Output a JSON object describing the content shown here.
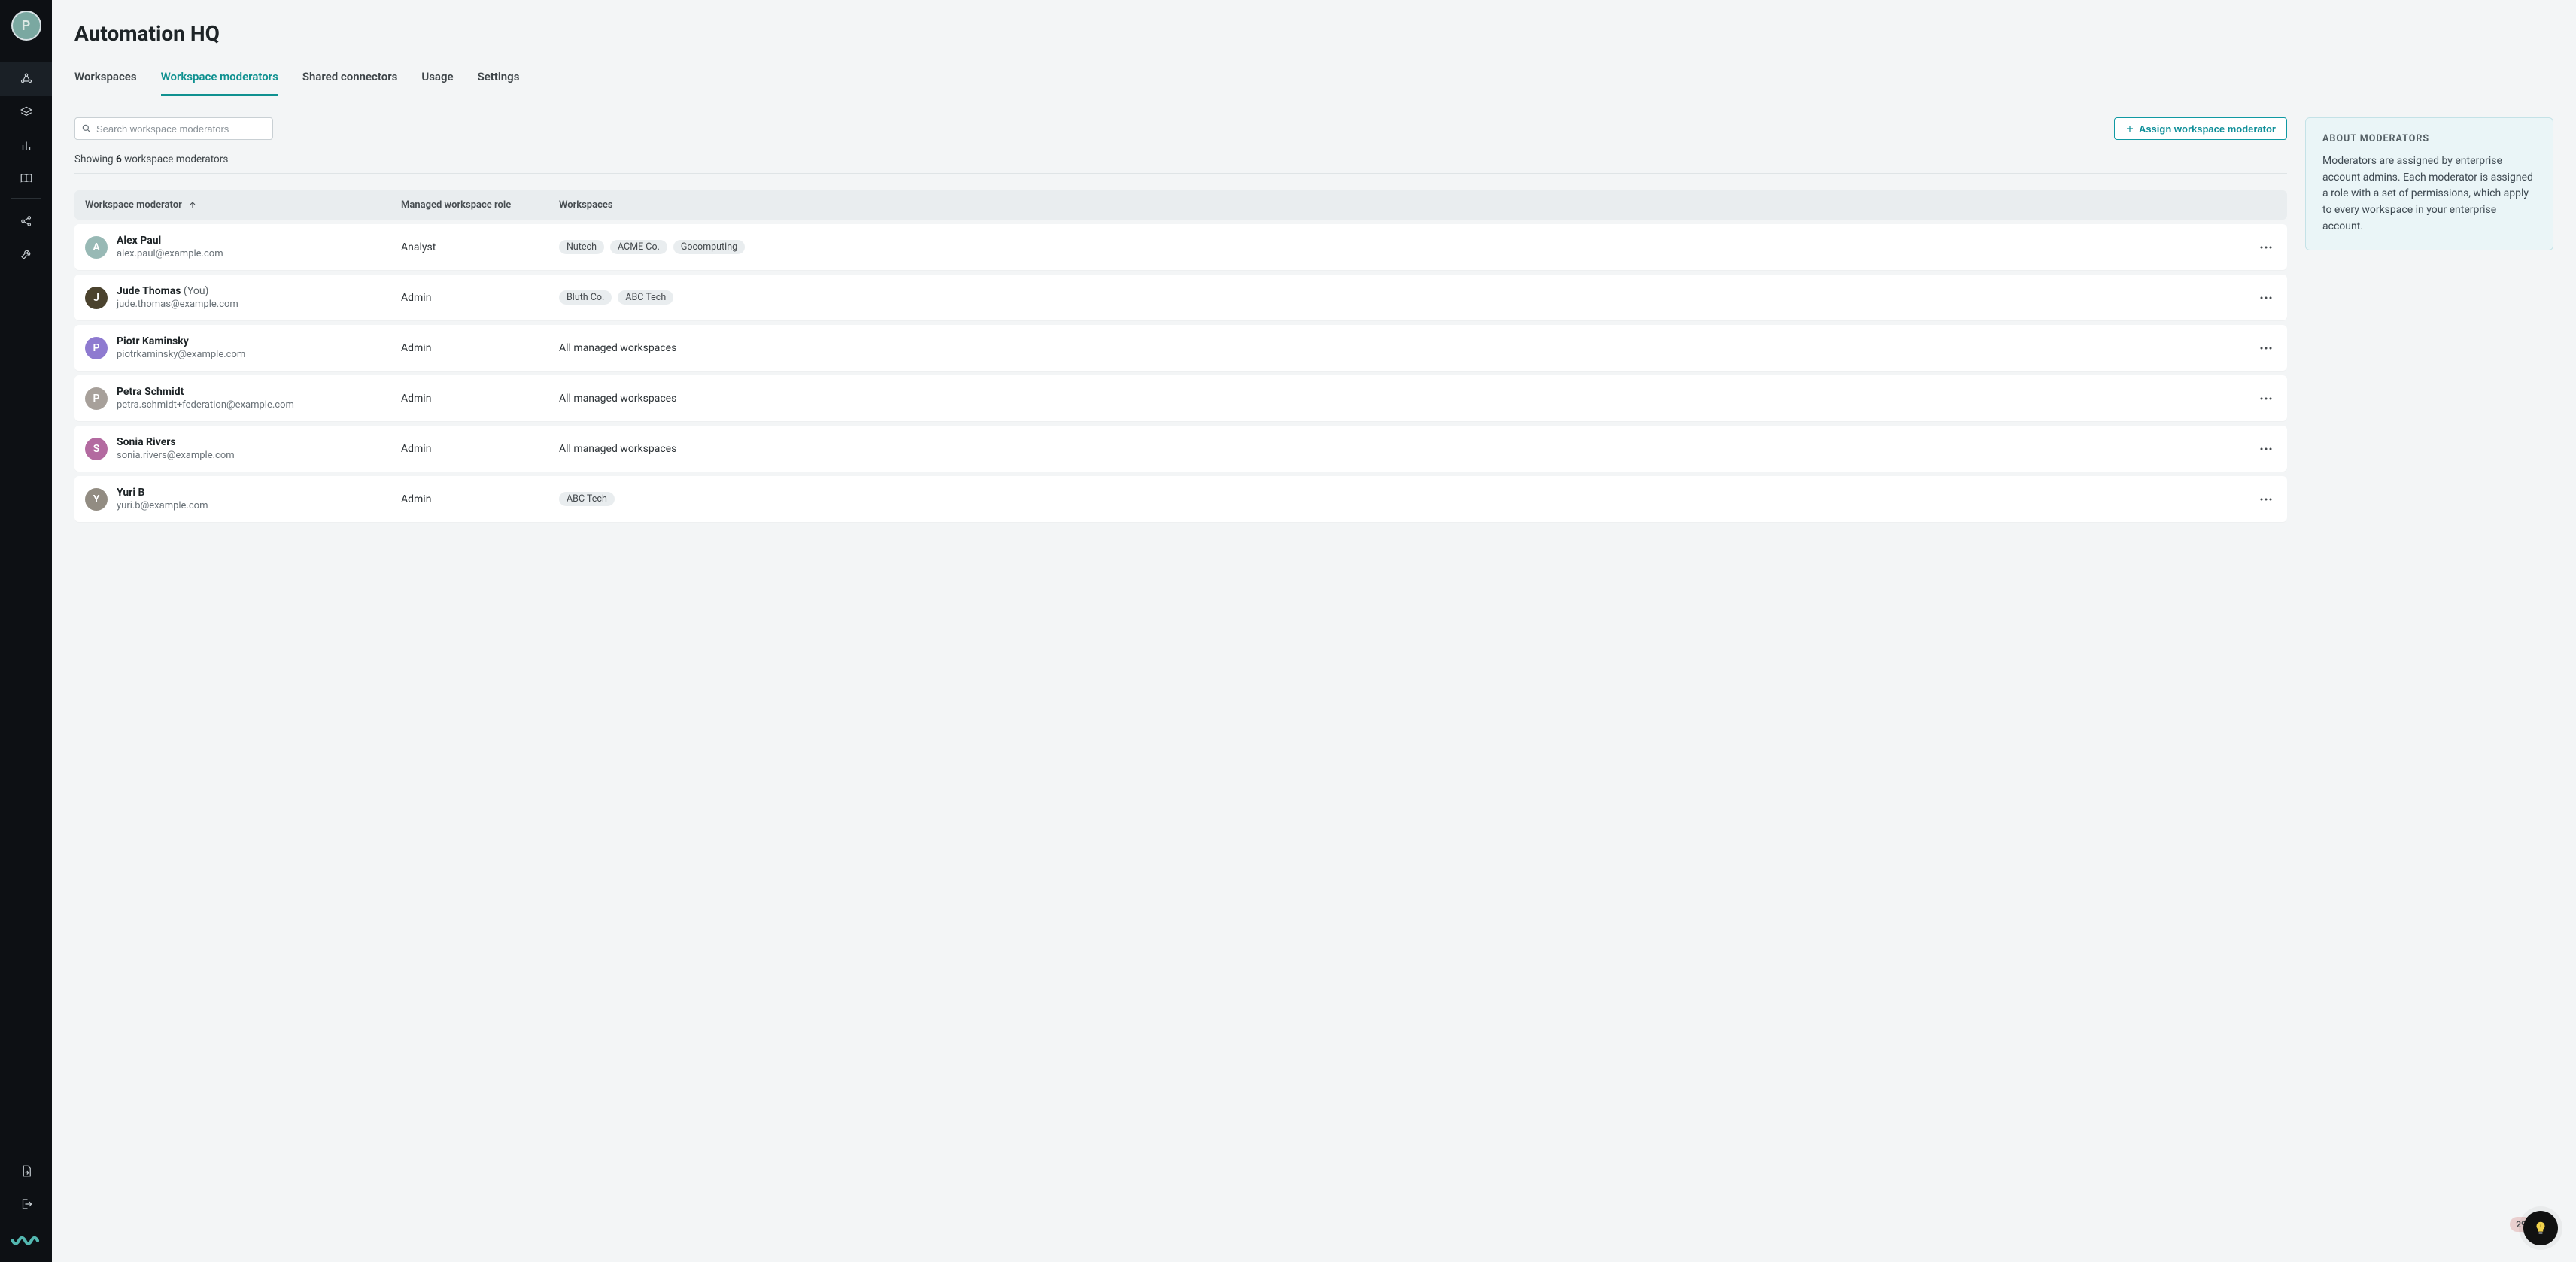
{
  "user": {
    "initial": "P"
  },
  "page_title": "Automation HQ",
  "tabs": [
    {
      "label": "Workspaces",
      "active": false
    },
    {
      "label": "Workspace moderators",
      "active": true
    },
    {
      "label": "Shared connectors",
      "active": false
    },
    {
      "label": "Usage",
      "active": false
    },
    {
      "label": "Settings",
      "active": false
    }
  ],
  "search": {
    "placeholder": "Search workspace moderators"
  },
  "assign_button": "Assign workspace moderator",
  "showing": {
    "prefix": "Showing ",
    "count": "6",
    "suffix": " workspace moderators"
  },
  "columns": {
    "moderator": "Workspace moderator",
    "role": "Managed workspace role",
    "workspaces": "Workspaces"
  },
  "info": {
    "title": "ABOUT MODERATORS",
    "body": "Moderators are assigned by enterprise account admins. Each moderator is assigned a role with a set of permissions, which apply to every workspace in your enterprise account."
  },
  "moderators": [
    {
      "initial": "A",
      "color": "#98b9b5",
      "name": "Alex Paul",
      "you": false,
      "email": "alex.paul@example.com",
      "role": "Analyst",
      "all": false,
      "tags": [
        "Nutech",
        "ACME Co.",
        "Gocomputing"
      ]
    },
    {
      "initial": "J",
      "color": "#4b432e",
      "name": "Jude Thomas",
      "you": true,
      "email": "jude.thomas@example.com",
      "role": "Admin",
      "all": false,
      "tags": [
        "Bluth Co.",
        "ABC Tech"
      ]
    },
    {
      "initial": "P",
      "color": "#8e7ad0",
      "name": "Piotr Kaminsky",
      "you": false,
      "email": "piotrkaminsky@example.com",
      "role": "Admin",
      "all": true,
      "tags": []
    },
    {
      "initial": "P",
      "color": "#a7a09a",
      "name": "Petra Schmidt",
      "you": false,
      "email": "petra.schmidt+federation@example.com",
      "role": "Admin",
      "all": true,
      "tags": []
    },
    {
      "initial": "S",
      "color": "#b36aa0",
      "name": "Sonia Rivers",
      "you": false,
      "email": "sonia.rivers@example.com",
      "role": "Admin",
      "all": true,
      "tags": []
    },
    {
      "initial": "Y",
      "color": "#928c82",
      "name": "Yuri B",
      "you": false,
      "email": "yuri.b@example.com",
      "role": "Admin",
      "all": false,
      "tags": [
        "ABC Tech"
      ]
    }
  ],
  "all_workspaces_label": "All managed workspaces",
  "you_label": "(You)",
  "notification_count": "29"
}
